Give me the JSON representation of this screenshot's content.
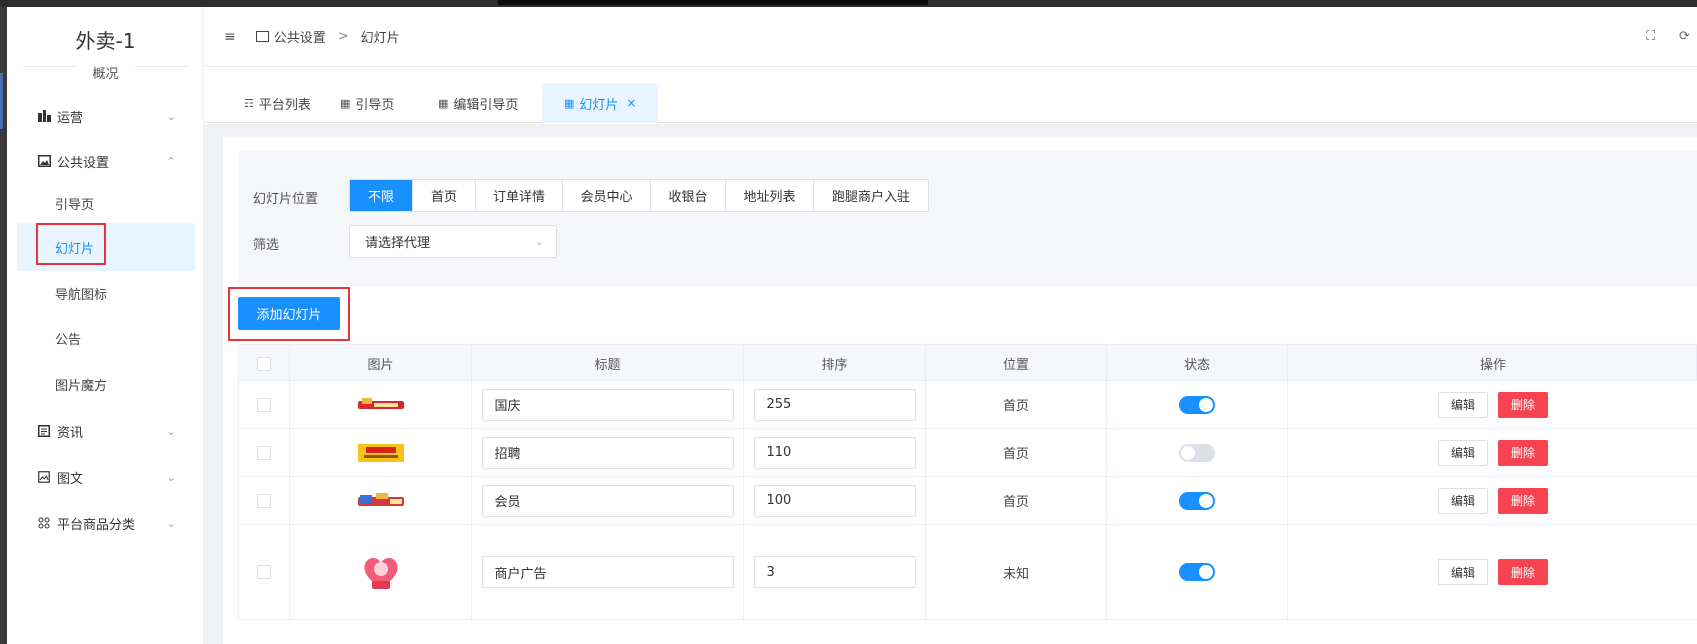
{
  "sidebar": {
    "brand": "外卖-1",
    "brand_sub": "概况",
    "menus": [
      {
        "label": "运营",
        "icon": "chart-bar-icon",
        "expanded": false
      },
      {
        "label": "公共设置",
        "icon": "image-icon",
        "expanded": true
      },
      {
        "label": "资讯",
        "icon": "news-icon",
        "expanded": false
      },
      {
        "label": "图文",
        "icon": "picture-text-icon",
        "expanded": false
      },
      {
        "label": "平台商品分类",
        "icon": "grid-icon",
        "expanded": false
      }
    ],
    "sub_items": [
      "引导页",
      "幻灯片",
      "导航图标",
      "公告",
      "图片魔方"
    ],
    "active_sub": "幻灯片"
  },
  "header": {
    "breadcrumb": [
      "公共设置",
      "幻灯片"
    ],
    "breadcrumb_sep": ">"
  },
  "tabs": [
    {
      "label": "平台列表",
      "active": false
    },
    {
      "label": "引导页",
      "active": false
    },
    {
      "label": "编辑引导页",
      "active": false
    },
    {
      "label": "幻灯片",
      "active": true,
      "close": "×"
    }
  ],
  "filter": {
    "position_label": "幻灯片位置",
    "positions": [
      "不限",
      "首页",
      "订单详情",
      "会员中心",
      "收银台",
      "地址列表",
      "跑腿商户入驻"
    ],
    "active_position": "不限",
    "screen_label": "筛选",
    "agent_placeholder": "请选择代理"
  },
  "add_button": "添加幻灯片",
  "table": {
    "columns": [
      "图片",
      "标题",
      "排序",
      "位置",
      "状态",
      "操作"
    ],
    "rows": [
      {
        "title": "国庆",
        "sort": "255",
        "position": "首页",
        "enabled": true,
        "thumb": "banner-red"
      },
      {
        "title": "招聘",
        "sort": "110",
        "position": "首页",
        "enabled": false,
        "thumb": "banner-yellow"
      },
      {
        "title": "会员",
        "sort": "100",
        "position": "首页",
        "enabled": true,
        "thumb": "banner-red-blue"
      },
      {
        "title": "商户广告",
        "sort": "3",
        "position": "未知",
        "enabled": true,
        "thumb": "heart-poster"
      }
    ],
    "edit_label": "编辑",
    "delete_label": "删除"
  },
  "colors": {
    "primary": "#1890ff",
    "danger": "#f5434f",
    "highlight": "#e5353a"
  }
}
